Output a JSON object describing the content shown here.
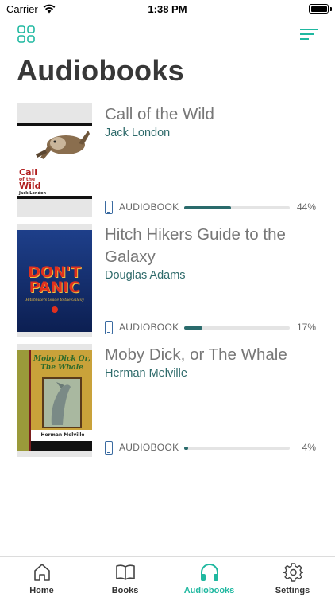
{
  "status_bar": {
    "carrier": "Carrier",
    "time": "1:38 PM"
  },
  "header": {
    "title": "Audiobooks",
    "left_icon": "grid-icon",
    "right_icon": "filter-list-icon"
  },
  "books": [
    {
      "title": "Call of the Wild",
      "author": "Jack London",
      "format": "AUDIOBOOK",
      "progress_text": "44%",
      "progress": 0.44,
      "cover": {
        "line1": "Call",
        "line2": "of the",
        "line3": "Wild",
        "byline": "Jack London"
      }
    },
    {
      "title": "Hitch Hikers Guide to the Galaxy",
      "author": "Douglas Adams",
      "format": "AUDIOBOOK",
      "progress_text": "17%",
      "progress": 0.17,
      "cover": {
        "line1": "DON'T",
        "line2": "PANIC",
        "line3": "Hitchhikers Guide to the Galaxy"
      }
    },
    {
      "title": "Moby Dick, or The Whale",
      "author": "Herman Melville",
      "format": "AUDIOBOOK",
      "progress_text": "4%",
      "progress": 0.04,
      "cover": {
        "line1": "Moby Dick Or,",
        "line2": "The Whale",
        "byline": "Herman Melville"
      }
    }
  ],
  "tabs": [
    {
      "label": "Home",
      "icon": "home-icon",
      "active": false
    },
    {
      "label": "Books",
      "icon": "book-icon",
      "active": false
    },
    {
      "label": "Audiobooks",
      "icon": "headphones-icon",
      "active": true
    },
    {
      "label": "Settings",
      "icon": "gear-icon",
      "active": false
    }
  ],
  "colors": {
    "accent": "#1fb8a0",
    "author": "#2f6b6b",
    "progress": "#2a6b6c",
    "device_icon": "#3a6aa0"
  }
}
